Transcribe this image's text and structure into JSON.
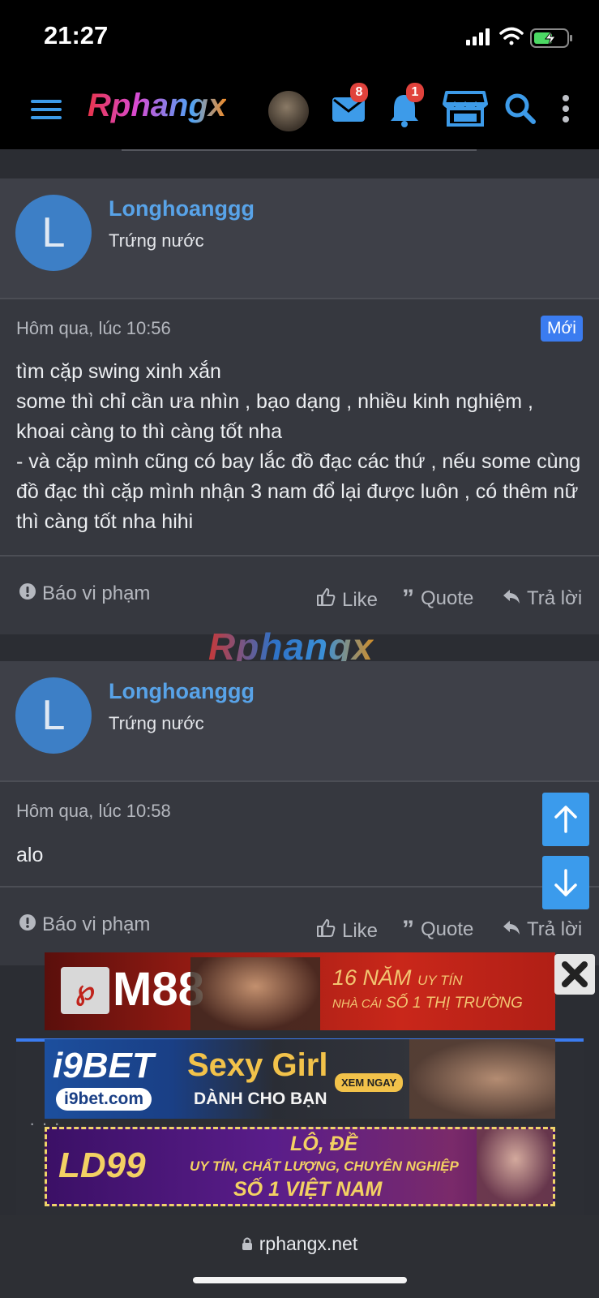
{
  "status": {
    "time": "21:27"
  },
  "nav": {
    "logo": "Rphangx",
    "messages_count": "8",
    "alerts_count": "1"
  },
  "posts": [
    {
      "username": "Longhoanggg",
      "user_title": "Trứng nước",
      "avatar_letter": "L",
      "date": "Hôm qua, lúc 10:56",
      "badge": "Mới",
      "text": "tìm cặp swing xinh xắn\nsome thì chỉ cần ưa nhìn , bạo dạng , nhiều kinh nghiệm , khoai càng to thì càng tốt nha\n- và cặp mình cũng có bay lắc đồ đạc các thứ , nếu some cùng đồ đạc thì cặp mình nhận 3 nam đổ lại được luôn , có thêm nữ thì càng tốt nha hihi",
      "report": "Báo vi phạm",
      "like": "Like",
      "quote": "Quote",
      "reply": "Trả lời"
    },
    {
      "username": "Longhoanggg",
      "user_title": "Trứng nước",
      "avatar_letter": "L",
      "date": "Hôm qua, lúc 10:58",
      "text": "alo",
      "report": "Báo vi phạm",
      "like": "Like",
      "quote": "Quote",
      "reply": "Trả lời"
    }
  ],
  "watermark": "Rphangx",
  "ads": [
    {
      "brand": "M88",
      "line1": "16 NĂM",
      "line1b": "UY TÍN",
      "line2": "NHÀ CÁI",
      "line2b": "SỐ 1 THỊ TRƯỜNG"
    },
    {
      "brand": "i9BET",
      "domain": "i9bet.com",
      "title": "Sexy Girl",
      "subtitle": "DÀNH CHO BẠN",
      "cta": "XEM NGAY"
    },
    {
      "brand": "LD99",
      "line1": "LÔ, ĐỀ",
      "line2": "UY TÍN, CHẤT LƯỢNG, CHUYÊN NGHIỆP",
      "line3": "SỐ 1 VIỆT NAM"
    }
  ],
  "browser": {
    "url": "rphangx.net"
  },
  "colors": {
    "accent": "#3b7cf0",
    "username": "#58a3e8",
    "fab": "#3b9bec",
    "badge": "#e0423c"
  }
}
